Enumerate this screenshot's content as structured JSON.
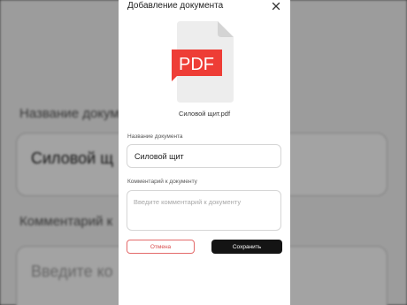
{
  "background": {
    "name_label": "Название докум",
    "name_value": "Силовой щ",
    "comment_label": "Комментарий к",
    "comment_placeholder": "Введите ко"
  },
  "modal": {
    "title": "Добавление документа",
    "close_icon": "close-icon",
    "file_badge": "PDF",
    "file_name": "Силовой щит.pdf",
    "name_label": "Название документа",
    "name_value": "Силовой щит",
    "comment_label": "Комментарий к документу",
    "comment_placeholder": "Введите комментарий к документу",
    "cancel_label": "Отмена",
    "save_label": "Сохранить"
  },
  "colors": {
    "pdf_red": "#ee3d36",
    "cancel_red": "#d84a4a",
    "save_bg": "#141414"
  }
}
